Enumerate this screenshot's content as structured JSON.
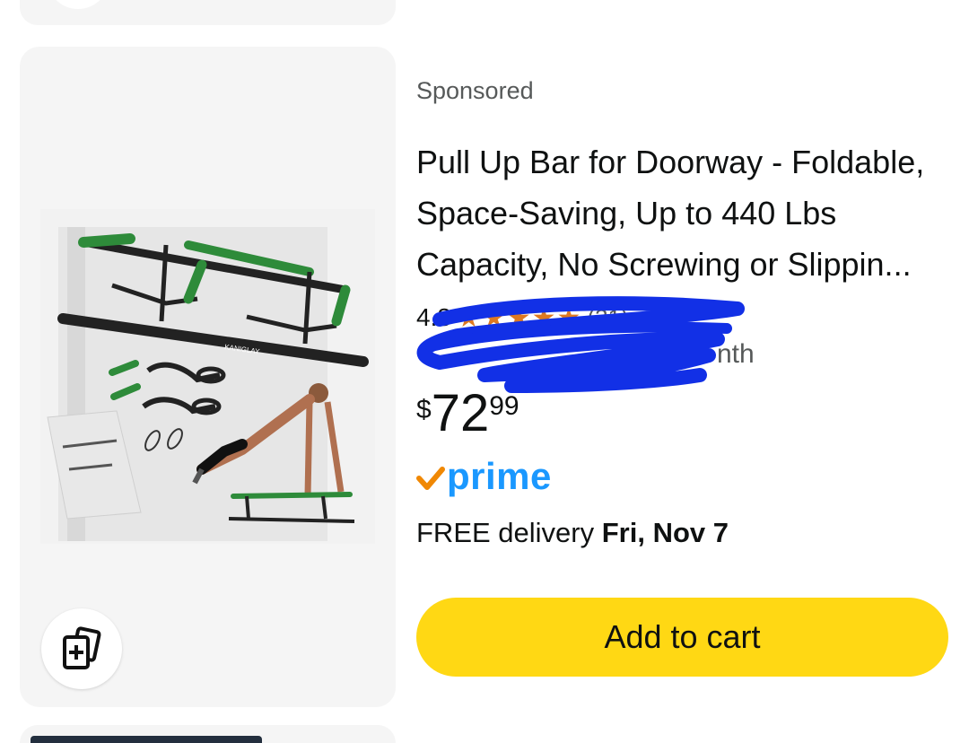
{
  "product": {
    "sponsored_label": "Sponsored",
    "title": "Pull Up Bar for Doorway - Foldable, Space-Saving, Up to 440 Lbs Capacity, No Screwing or Slippin...",
    "rating_value": "4.8",
    "stars_glyphs": "★★★★★",
    "review_count": "(31)",
    "bought_text": "nth",
    "price": {
      "symbol": "$",
      "whole": "72",
      "fraction": "99"
    },
    "prime_label": "prime",
    "delivery_prefix": "FREE delivery ",
    "delivery_date": "Fri, Nov 7",
    "add_to_cart_label": "Add to cart",
    "image_brand": "KANIGLAY"
  },
  "colors": {
    "card_bg": "#f5f5f5",
    "button_yellow": "#ffd814",
    "prime_blue": "#1a98ff",
    "prime_check": "#f08804",
    "star_orange": "#de7921",
    "scribble_blue": "#1230e6",
    "secondary_text": "#565959"
  },
  "icons": {
    "similar": "add-cards-icon",
    "prime_check": "prime-check-icon"
  }
}
